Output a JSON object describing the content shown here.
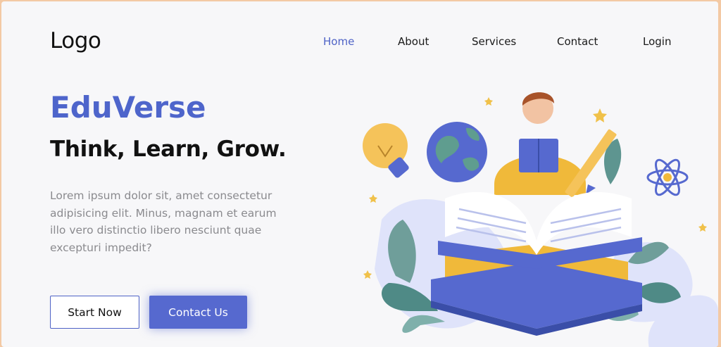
{
  "header": {
    "logo": "Logo",
    "nav": [
      {
        "label": "Home",
        "active": true
      },
      {
        "label": "About",
        "active": false
      },
      {
        "label": "Services",
        "active": false
      },
      {
        "label": "Contact",
        "active": false
      },
      {
        "label": "Login",
        "active": false
      }
    ]
  },
  "hero": {
    "brand": "EduVerse",
    "tagline": "Think, Learn, Grow.",
    "description": "Lorem ipsum dolor sit, amet consectetur adipisicing elit. Minus, magnam et earum illo vero distinctio libero nesciunt quae excepturi impedit?",
    "start_label": "Start Now",
    "contact_label": "Contact Us"
  },
  "colors": {
    "accent": "#4e65cb",
    "page_border": "#f3c9a4",
    "background": "#f7f7f9"
  },
  "illustration": {
    "icons": [
      "lightbulb-icon",
      "globe-icon",
      "atom-icon",
      "pencil-icon",
      "star-icon"
    ]
  }
}
